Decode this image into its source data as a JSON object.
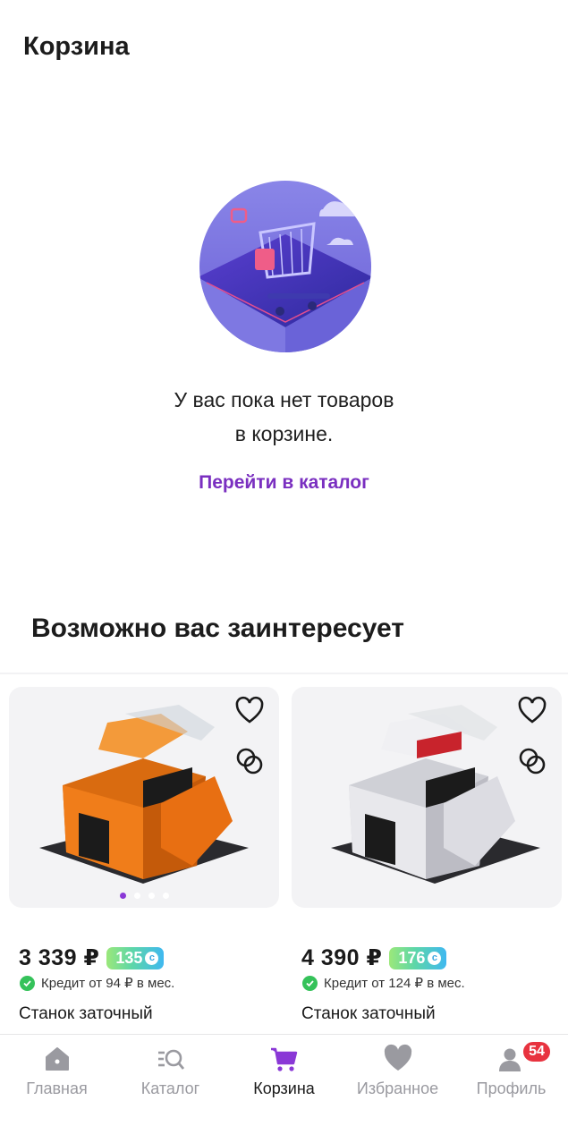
{
  "header": {
    "title": "Корзина"
  },
  "empty_state": {
    "message_line1": "У вас пока нет товаров",
    "message_line2": "в корзине.",
    "link_label": "Перейти в каталог"
  },
  "recommendations": {
    "title": "Возможно вас заинтересует",
    "products": [
      {
        "price": "3 339 ₽",
        "bonus": "135",
        "credit": "Кредит от 94 ₽ в мес.",
        "name": "Станок заточный",
        "color": "#f07d1a",
        "image_dots": 4,
        "active_dot": 0
      },
      {
        "price": "4 390 ₽",
        "bonus": "176",
        "credit": "Кредит от 124 ₽ в мес.",
        "name": "Станок заточный",
        "color": "#e8e8ec"
      }
    ]
  },
  "tabbar": {
    "tabs": [
      {
        "label": "Главная",
        "icon": "home-icon"
      },
      {
        "label": "Каталог",
        "icon": "catalog-search-icon"
      },
      {
        "label": "Корзина",
        "icon": "cart-icon",
        "active": true
      },
      {
        "label": "Избранное",
        "icon": "heart-icon"
      },
      {
        "label": "Профиль",
        "icon": "profile-icon",
        "badge": "54"
      }
    ]
  },
  "colors": {
    "accent": "#7a2fc0",
    "badge": "#e8333f",
    "inactive": "#9a9aa0"
  }
}
